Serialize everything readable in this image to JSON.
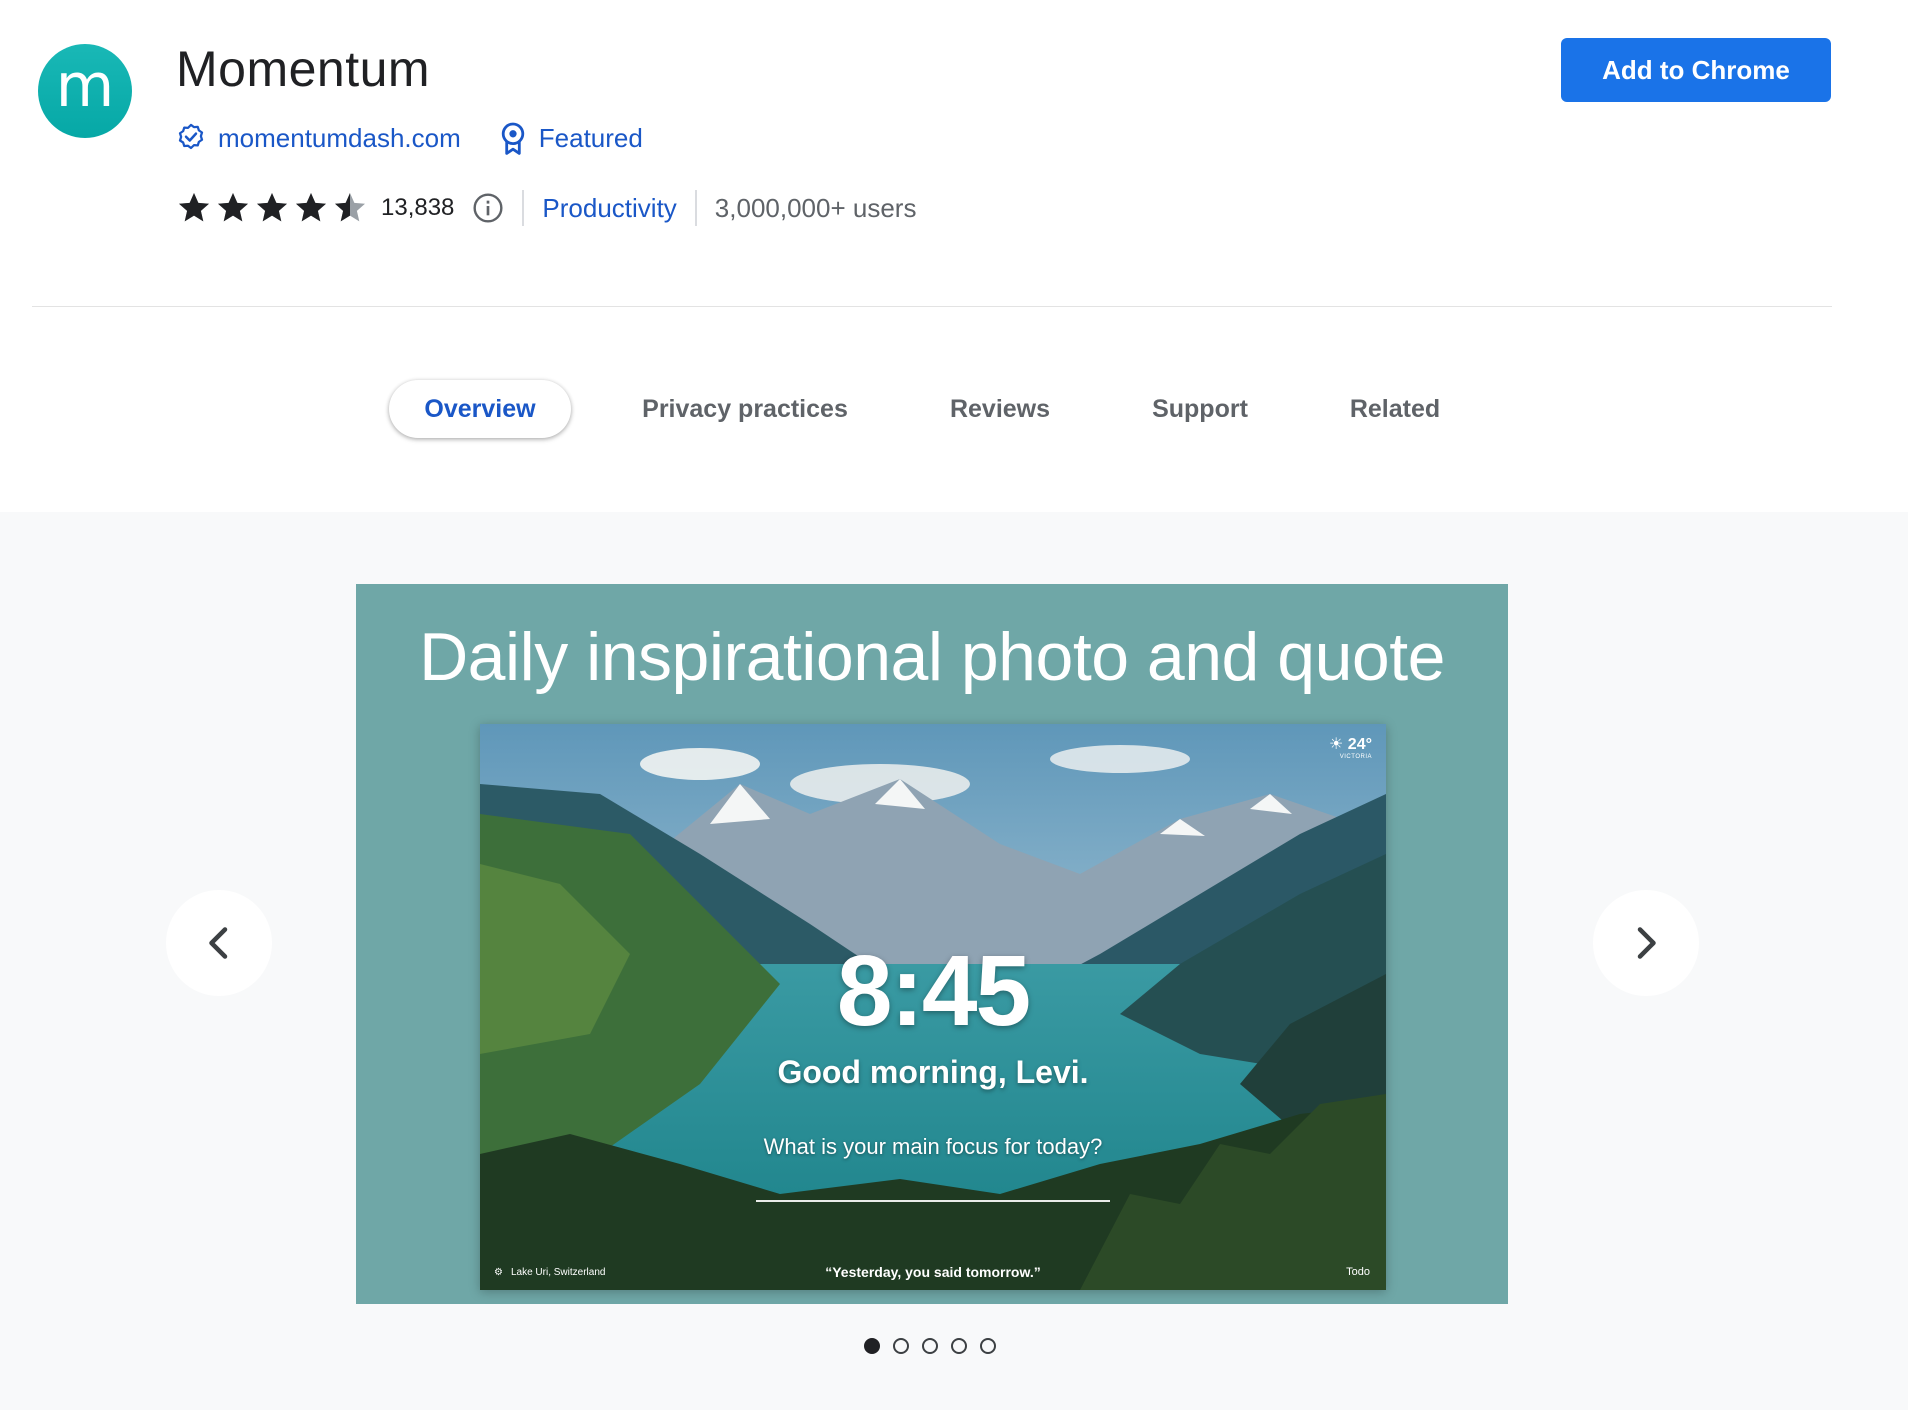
{
  "extension": {
    "logo_letter": "m",
    "name": "Momentum",
    "website": "momentumdash.com",
    "featured_label": "Featured",
    "rating_value": 4.5,
    "rating_count": "13,838",
    "category": "Productivity",
    "users": "3,000,000+ users"
  },
  "actions": {
    "add_button": "Add to Chrome"
  },
  "tabs": [
    {
      "label": "Overview",
      "active": true
    },
    {
      "label": "Privacy practices",
      "active": false
    },
    {
      "label": "Reviews",
      "active": false
    },
    {
      "label": "Support",
      "active": false
    },
    {
      "label": "Related",
      "active": false
    }
  ],
  "gallery": {
    "slide_heading": "Daily inspirational photo and quote",
    "screen": {
      "weather_temp": "24°",
      "weather_location": "VICTORIA",
      "time": "8:45",
      "greeting": "Good morning, Levi.",
      "focus_prompt": "What is your main focus for today?",
      "photo_location": "Lake Uri, Switzerland",
      "quote": "“Yesterday, you said tomorrow.”",
      "todo": "Todo"
    },
    "slide_count": 5,
    "current_slide": 1
  },
  "colors": {
    "accent": "#1a73e8",
    "link": "#1a57c7",
    "logo": "#0fb0ae",
    "slide_bg": "#6fa7a7",
    "gallery_bg": "#f8f9fa"
  },
  "icons": {
    "verified": "verified-badge-icon",
    "featured": "featured-ribbon-icon",
    "info": "info-icon",
    "prev": "chevron-left-icon",
    "next": "chevron-right-icon"
  }
}
